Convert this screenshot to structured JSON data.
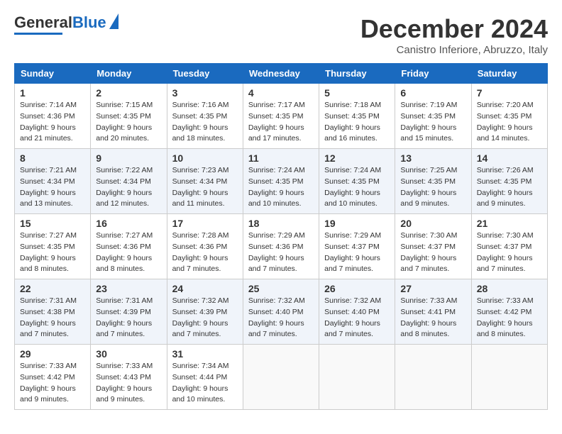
{
  "header": {
    "logo_general": "General",
    "logo_blue": "Blue",
    "month_title": "December 2024",
    "subtitle": "Canistro Inferiore, Abruzzo, Italy"
  },
  "weekdays": [
    "Sunday",
    "Monday",
    "Tuesday",
    "Wednesday",
    "Thursday",
    "Friday",
    "Saturday"
  ],
  "weeks": [
    [
      {
        "day": "1",
        "sunrise": "7:14 AM",
        "sunset": "4:36 PM",
        "daylight_hours": "9 hours and 21 minutes."
      },
      {
        "day": "2",
        "sunrise": "7:15 AM",
        "sunset": "4:35 PM",
        "daylight_hours": "9 hours and 20 minutes."
      },
      {
        "day": "3",
        "sunrise": "7:16 AM",
        "sunset": "4:35 PM",
        "daylight_hours": "9 hours and 18 minutes."
      },
      {
        "day": "4",
        "sunrise": "7:17 AM",
        "sunset": "4:35 PM",
        "daylight_hours": "9 hours and 17 minutes."
      },
      {
        "day": "5",
        "sunrise": "7:18 AM",
        "sunset": "4:35 PM",
        "daylight_hours": "9 hours and 16 minutes."
      },
      {
        "day": "6",
        "sunrise": "7:19 AM",
        "sunset": "4:35 PM",
        "daylight_hours": "9 hours and 15 minutes."
      },
      {
        "day": "7",
        "sunrise": "7:20 AM",
        "sunset": "4:35 PM",
        "daylight_hours": "9 hours and 14 minutes."
      }
    ],
    [
      {
        "day": "8",
        "sunrise": "7:21 AM",
        "sunset": "4:34 PM",
        "daylight_hours": "9 hours and 13 minutes."
      },
      {
        "day": "9",
        "sunrise": "7:22 AM",
        "sunset": "4:34 PM",
        "daylight_hours": "9 hours and 12 minutes."
      },
      {
        "day": "10",
        "sunrise": "7:23 AM",
        "sunset": "4:34 PM",
        "daylight_hours": "9 hours and 11 minutes."
      },
      {
        "day": "11",
        "sunrise": "7:24 AM",
        "sunset": "4:35 PM",
        "daylight_hours": "9 hours and 10 minutes."
      },
      {
        "day": "12",
        "sunrise": "7:24 AM",
        "sunset": "4:35 PM",
        "daylight_hours": "9 hours and 10 minutes."
      },
      {
        "day": "13",
        "sunrise": "7:25 AM",
        "sunset": "4:35 PM",
        "daylight_hours": "9 hours and 9 minutes."
      },
      {
        "day": "14",
        "sunrise": "7:26 AM",
        "sunset": "4:35 PM",
        "daylight_hours": "9 hours and 9 minutes."
      }
    ],
    [
      {
        "day": "15",
        "sunrise": "7:27 AM",
        "sunset": "4:35 PM",
        "daylight_hours": "9 hours and 8 minutes."
      },
      {
        "day": "16",
        "sunrise": "7:27 AM",
        "sunset": "4:36 PM",
        "daylight_hours": "9 hours and 8 minutes."
      },
      {
        "day": "17",
        "sunrise": "7:28 AM",
        "sunset": "4:36 PM",
        "daylight_hours": "9 hours and 7 minutes."
      },
      {
        "day": "18",
        "sunrise": "7:29 AM",
        "sunset": "4:36 PM",
        "daylight_hours": "9 hours and 7 minutes."
      },
      {
        "day": "19",
        "sunrise": "7:29 AM",
        "sunset": "4:37 PM",
        "daylight_hours": "9 hours and 7 minutes."
      },
      {
        "day": "20",
        "sunrise": "7:30 AM",
        "sunset": "4:37 PM",
        "daylight_hours": "9 hours and 7 minutes."
      },
      {
        "day": "21",
        "sunrise": "7:30 AM",
        "sunset": "4:37 PM",
        "daylight_hours": "9 hours and 7 minutes."
      }
    ],
    [
      {
        "day": "22",
        "sunrise": "7:31 AM",
        "sunset": "4:38 PM",
        "daylight_hours": "9 hours and 7 minutes."
      },
      {
        "day": "23",
        "sunrise": "7:31 AM",
        "sunset": "4:39 PM",
        "daylight_hours": "9 hours and 7 minutes."
      },
      {
        "day": "24",
        "sunrise": "7:32 AM",
        "sunset": "4:39 PM",
        "daylight_hours": "9 hours and 7 minutes."
      },
      {
        "day": "25",
        "sunrise": "7:32 AM",
        "sunset": "4:40 PM",
        "daylight_hours": "9 hours and 7 minutes."
      },
      {
        "day": "26",
        "sunrise": "7:32 AM",
        "sunset": "4:40 PM",
        "daylight_hours": "9 hours and 7 minutes."
      },
      {
        "day": "27",
        "sunrise": "7:33 AM",
        "sunset": "4:41 PM",
        "daylight_hours": "9 hours and 8 minutes."
      },
      {
        "day": "28",
        "sunrise": "7:33 AM",
        "sunset": "4:42 PM",
        "daylight_hours": "9 hours and 8 minutes."
      }
    ],
    [
      {
        "day": "29",
        "sunrise": "7:33 AM",
        "sunset": "4:42 PM",
        "daylight_hours": "9 hours and 9 minutes."
      },
      {
        "day": "30",
        "sunrise": "7:33 AM",
        "sunset": "4:43 PM",
        "daylight_hours": "9 hours and 9 minutes."
      },
      {
        "day": "31",
        "sunrise": "7:34 AM",
        "sunset": "4:44 PM",
        "daylight_hours": "9 hours and 10 minutes."
      },
      null,
      null,
      null,
      null
    ]
  ],
  "labels": {
    "sunrise": "Sunrise:",
    "sunset": "Sunset:",
    "daylight": "Daylight:"
  }
}
